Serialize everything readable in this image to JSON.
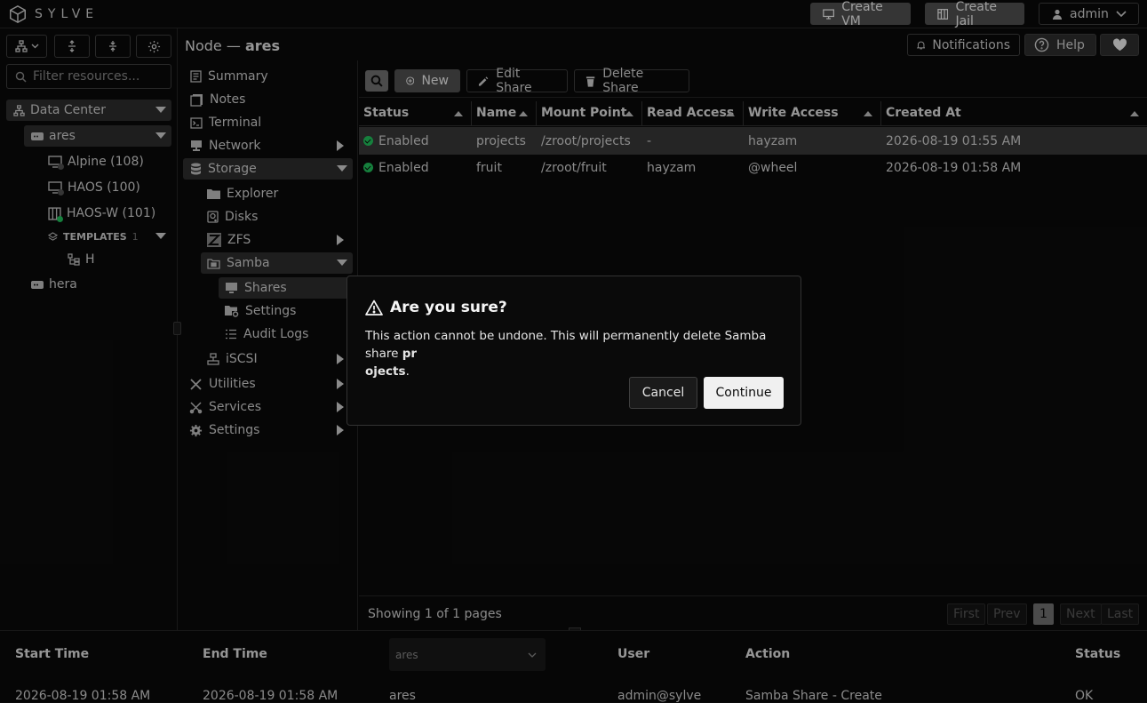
{
  "app": {
    "name": "SYLVE"
  },
  "topbar": {
    "create_vm": "Create VM",
    "create_jail": "Create Jail",
    "user": "admin"
  },
  "header": {
    "node_prefix": "Node —",
    "node_name": "ares",
    "notifications": "Notifications",
    "help": "Help"
  },
  "sidebar": {
    "filter_placeholder": "Filter resources...",
    "datacenter": "Data Center",
    "nodes": [
      {
        "name": "ares",
        "items": [
          "Alpine (108)",
          "HAOS (100)",
          "HAOS-W (101)"
        ],
        "templates_label": "TEMPLATES",
        "templates_count": "1",
        "template_items": [
          "H"
        ]
      },
      {
        "name": "hera"
      }
    ]
  },
  "nav": {
    "items": [
      "Summary",
      "Notes",
      "Terminal",
      "Network",
      "Storage",
      "Explorer",
      "Disks",
      "ZFS",
      "Samba",
      "Shares",
      "Settings",
      "Audit Logs",
      "iSCSI",
      "Utilities",
      "Services",
      "Settings"
    ]
  },
  "toolbar": {
    "new": "New",
    "edit": "Edit Share",
    "delete": "Delete Share"
  },
  "table": {
    "columns": [
      "Status",
      "Name",
      "Mount Point",
      "Read Access",
      "Write Access",
      "Created At"
    ],
    "rows": [
      {
        "status": "Enabled",
        "name": "projects",
        "mount": "/zroot/projects",
        "read": "-",
        "write": "hayzam",
        "created": "2026-08-19 01:55 AM"
      },
      {
        "status": "Enabled",
        "name": "fruit",
        "mount": "/zroot/fruit",
        "read": "hayzam",
        "write": "@wheel",
        "created": "2026-08-19 01:58 AM"
      }
    ],
    "showing": "Showing 1 of 1 pages",
    "pager": {
      "first": "First",
      "prev": "Prev",
      "page": "1",
      "next": "Next",
      "last": "Last"
    }
  },
  "bottom": {
    "columns": [
      "Start Time",
      "End Time",
      "User",
      "Action",
      "Status"
    ],
    "node_select": "ares",
    "row": {
      "start": "2026-08-19 01:58 AM",
      "end": "2026-08-19 01:58 AM",
      "node": "ares",
      "user": "admin@sylve",
      "action": "Samba Share - Create",
      "status": "OK"
    }
  },
  "dialog": {
    "title": "Are you sure?",
    "body_prefix": "This action cannot be undone. This will permanently delete Samba share ",
    "share_name_a": "pr",
    "share_name_b": "ojects",
    "body_suffix": ".",
    "cancel": "Cancel",
    "continue": "Continue"
  },
  "colors": {
    "enabled": "#22c55e",
    "selected_row": "#3a3a3a",
    "background": "#0a0a0a"
  }
}
